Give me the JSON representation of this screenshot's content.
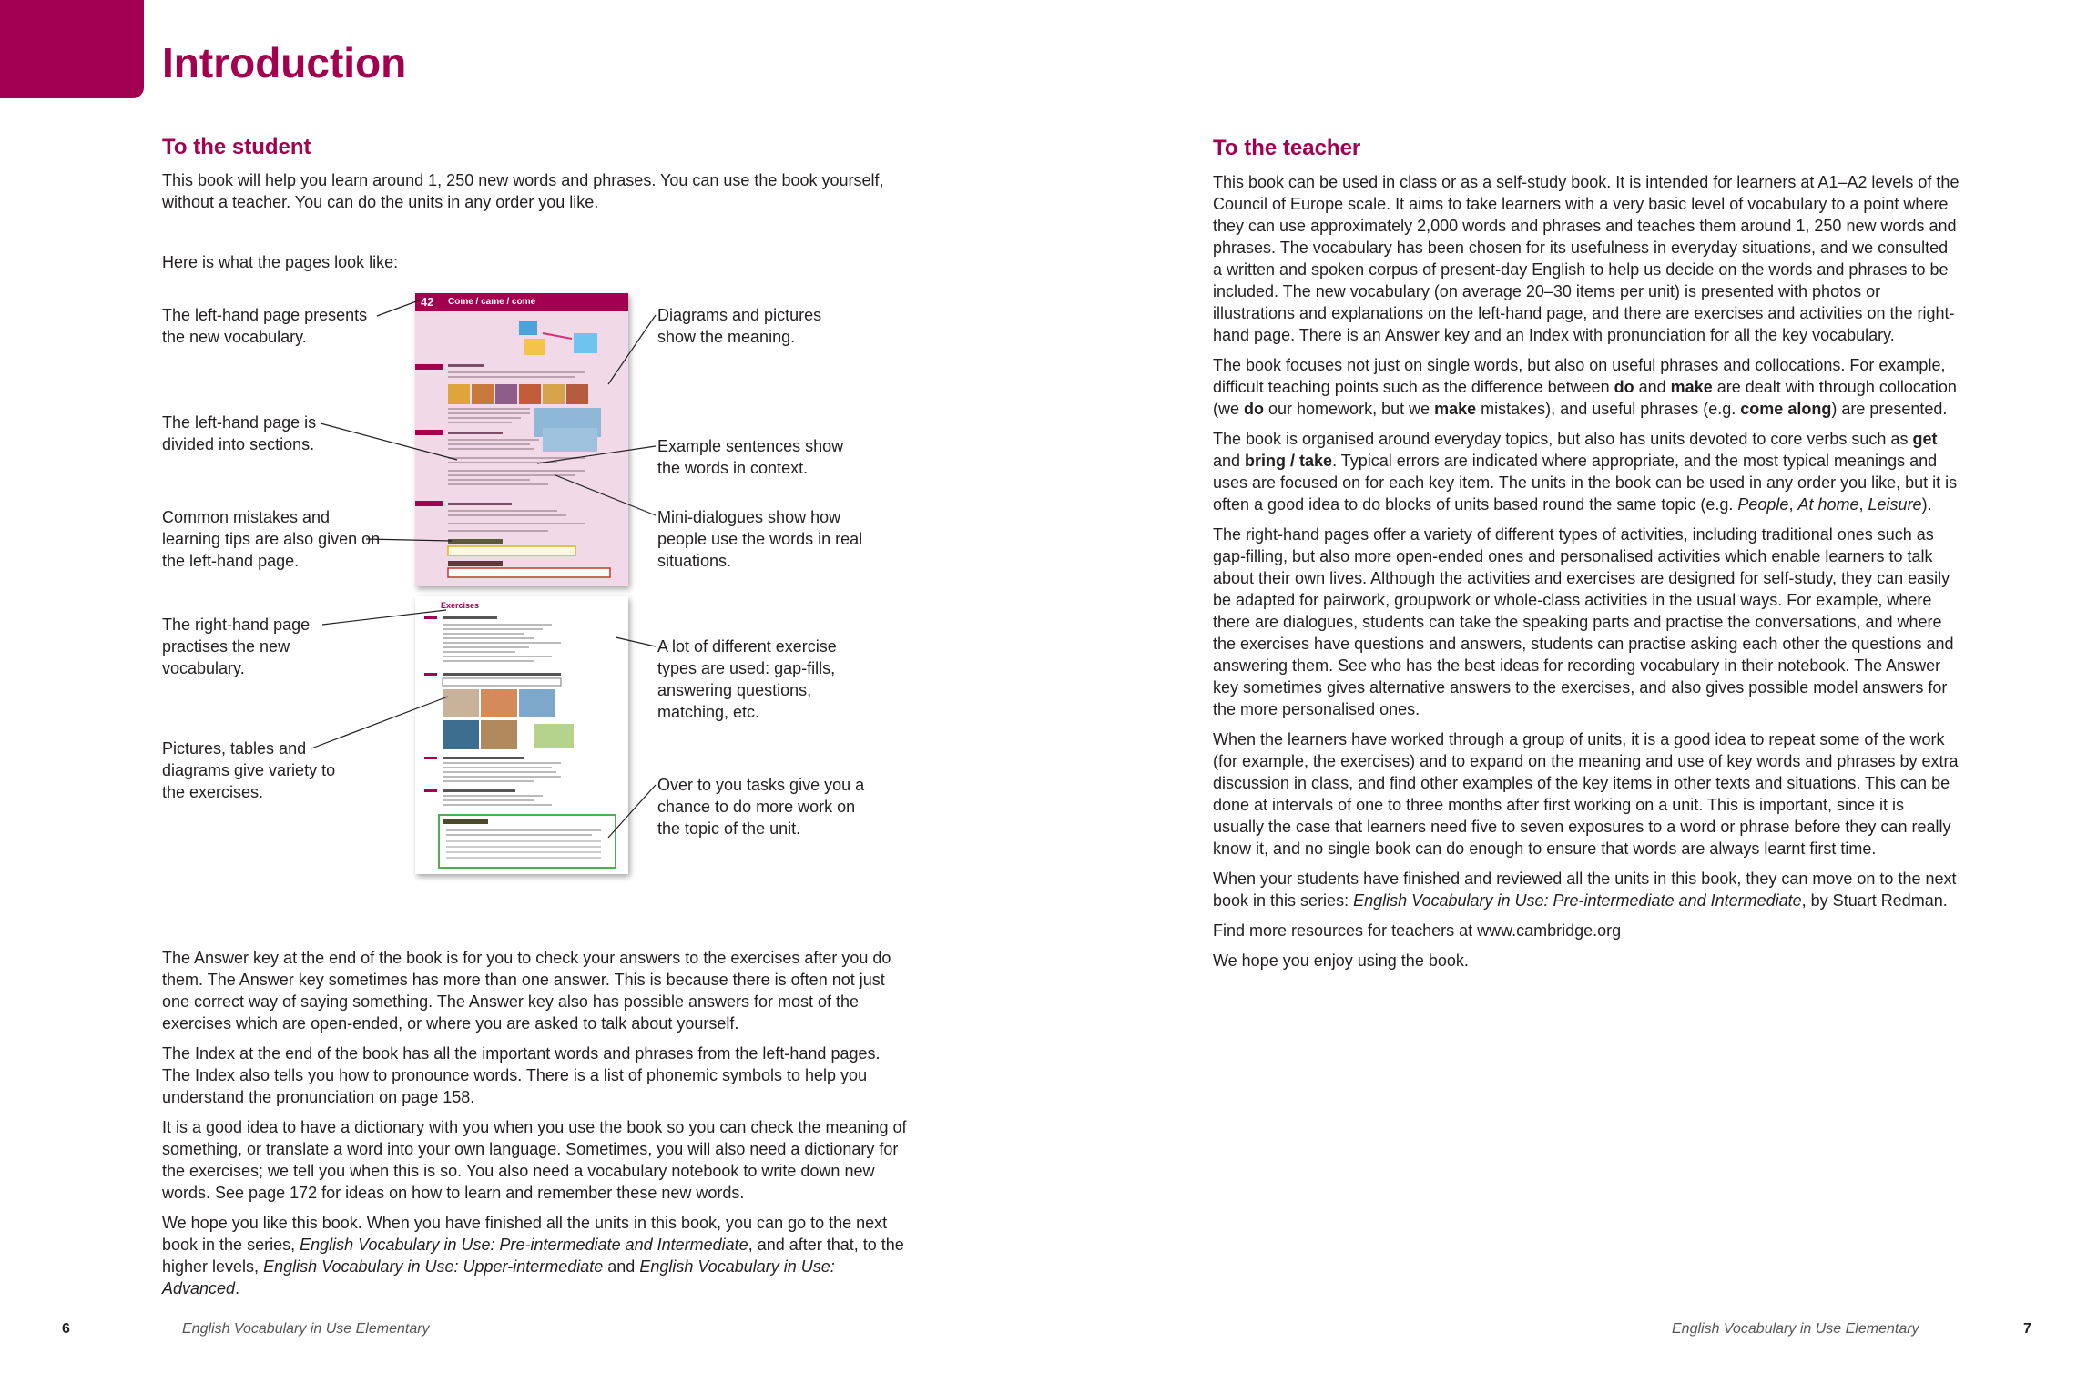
{
  "left": {
    "title": "Introduction",
    "student_heading": "To the student",
    "student_intro_1": "This book will help you learn around 1, 250 new words and phrases. You can use the book yourself, without a teacher. You can do the units in any order you like.",
    "student_intro_2": "Here is what the pages look like:",
    "callouts": {
      "c1": "The left-hand page presents the new vocabulary.",
      "c2": "The left-hand page is divided into sections.",
      "c3": "Common mistakes and learning tips are also given on the left-hand page.",
      "c4": "The right-hand page practises the new vocabulary.",
      "c5": "Pictures, tables and diagrams give variety to the exercises.",
      "c6": "Diagrams and pictures show the meaning.",
      "c7": "Example sentences show the words in context.",
      "c8": "Mini-dialogues show how people use the words in real situations.",
      "c9": "A lot of different exercise types are used: gap-fills, answering questions, matching, etc.",
      "c10": "Over to you tasks give you a chance to do more work on the topic of the unit."
    },
    "thumb_unit_number": "42",
    "thumb_unit_title": "Come / came / come",
    "thumb_exercises_label": "Exercises",
    "para_answer_key": "The Answer key at the end of the book is for you to check your answers to the exercises after you do them. The Answer key sometimes has more than one answer. This is because there is often not just one correct way of saying something. The Answer key also has possible answers for most of the exercises which are open-ended, or where you are asked to talk about yourself.",
    "para_index": "The Index at the end of the book has all the important words and phrases from the left-hand pages. The Index also tells you how to pronounce words. There is a list of phonemic symbols to help you understand the pronunciation on page 158.",
    "para_dictionary": "It is a good idea to have a dictionary with you when you use the book so you can check the meaning of something, or translate a word into your own language. Sometimes, you will also need a dictionary for the exercises; we tell you when this is so. You also need a vocabulary notebook to write down new words. See page 172 for ideas on how to learn and remember these new words.",
    "para_hope": {
      "a": "We hope you like this book. When you have finished all the units in this book, you can go to the next book in the series, ",
      "i1": "English Vocabulary in Use: Pre-intermediate and Intermediate",
      "b": ", and after that, to the higher levels, ",
      "i2": "English Vocabulary in Use: Upper-intermediate",
      "c": " and ",
      "i3": "English Vocabulary in Use: Advanced",
      "d": "."
    },
    "footer_page": "6",
    "footer_title": "English Vocabulary in Use Elementary"
  },
  "right": {
    "teacher_heading": "To the teacher",
    "p1": "This book can be used in class or as a self-study book. It is intended for learners at A1–A2 levels of the Council of Europe scale. It aims to take learners with a very basic level of vocabulary to a point where they can use approximately 2,000 words and phrases and teaches them around 1, 250 new words and phrases. The vocabulary has been chosen for its usefulness in everyday situations, and we consulted a written and spoken corpus of present-day English to help us decide on the words and phrases to be included. The new vocabulary (on average 20–30 items per unit) is presented with photos or illustrations and explanations on the left-hand page, and there are exercises and activities on the right-hand page. There is an Answer key and an Index with pronunciation for all the key vocabulary.",
    "p2": {
      "a": "The book focuses not just on single words, but also on useful phrases and collocations. For example, difficult teaching points such as the difference between ",
      "b1": "do",
      "b": " and ",
      "b2": "make",
      "c": " are dealt with through collocation (we ",
      "b3": "do",
      "d": " our homework, but we ",
      "b4": "make",
      "e": " mistakes), and useful phrases (e.g. ",
      "b5": "come along",
      "f": ") are presented."
    },
    "p3": {
      "a": "The book is organised around everyday topics, but also has units devoted to core verbs such as ",
      "b1": "get",
      "b": " and ",
      "b2": "bring / take",
      "c": ". Typical errors are indicated where appropriate, and the most typical meanings and uses are focused on for each key item. The units in the book can be used in any order you like, but it is often a good idea to do blocks of units based round the same topic (e.g. ",
      "i1": "People",
      "d": ", ",
      "i2": "At home",
      "e": ", ",
      "i3": "Leisure",
      "f": ")."
    },
    "p4": "The right-hand pages offer a variety of different types of activities, including traditional ones such as gap-filling, but also more open-ended ones and personalised activities which enable learners to talk about their own lives. Although the activities and exercises are designed for self-study, they can easily be adapted for pairwork, groupwork or whole-class activities in the usual ways. For example, where there are dialogues, students can take the speaking parts and practise the conversations, and where the exercises have questions and answers, students can practise asking each other the questions and answering them. See who has the best ideas for recording vocabulary in their notebook. The Answer key sometimes gives alternative answers to the exercises, and also gives possible model answers for the more personalised ones.",
    "p5": "When the learners have worked through a group of units, it is a good idea to repeat some of the work (for example, the exercises) and to expand on the meaning and use of key words and phrases by extra discussion in class, and find other examples of the key items in other texts and situations. This can be done at intervals of one to three months after first working on a unit. This is important, since it is usually the case that learners need five to seven exposures to a word or phrase before they can really know it, and no single book can do enough to ensure that words are always learnt first time.",
    "p6": {
      "a": "When your students have finished and reviewed all the units in this book, they can move on to the next book in this series: ",
      "i1": "English Vocabulary in Use: Pre-intermediate and Intermediate",
      "b": ", by Stuart Redman."
    },
    "p7": "Find more resources for teachers at www.cambridge.org",
    "p8": "We hope you enjoy using the book.",
    "footer_title": "English Vocabulary in Use Elementary",
    "footer_page": "7"
  },
  "colors": {
    "accent": "#a3004f",
    "text": "#231f20",
    "thumb_left_bg": "#f1d9e8"
  }
}
